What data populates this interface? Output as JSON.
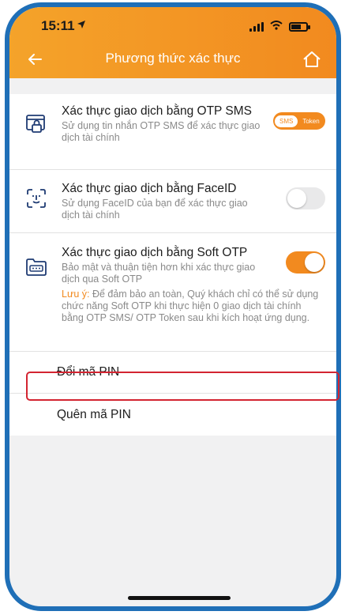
{
  "status_bar": {
    "time": "15:11"
  },
  "header": {
    "title": "Phương thức xác thực"
  },
  "settings": [
    {
      "title": "Xác thực giao dịch bằng OTP SMS",
      "subtitle": "Sử dụng tin nhắn OTP SMS để xác thực giao dịch tài chính",
      "control": "segment",
      "segment": {
        "option_a": "SMS",
        "option_b": "Token",
        "selected": "SMS"
      }
    },
    {
      "title": "Xác thực giao dịch bằng FaceID",
      "subtitle": "Sử dụng FaceID của bạn để xác thực giao dịch tài chính",
      "control": "toggle",
      "enabled": false
    },
    {
      "title": "Xác thực giao dịch bằng Soft OTP",
      "subtitle": "Bảo mật và thuận tiện hơn khi xác thực giao dịch qua Soft OTP",
      "control": "toggle",
      "enabled": true,
      "note_label": "Lưu ý:",
      "note_text": " Để đảm bảo an toàn, Quý khách chỉ có thể sử dụng chức năng Soft OTP khi thực hiện 0 giao dịch tài chính bằng OTP SMS/ OTP Token sau khi kích hoạt ứng dụng."
    }
  ],
  "menu": [
    {
      "label": "Đổi mã PIN"
    },
    {
      "label": "Quên mã PIN"
    }
  ],
  "colors": {
    "accent": "#f28a1f",
    "frame": "#1f6fb7",
    "highlight": "#d32431"
  }
}
